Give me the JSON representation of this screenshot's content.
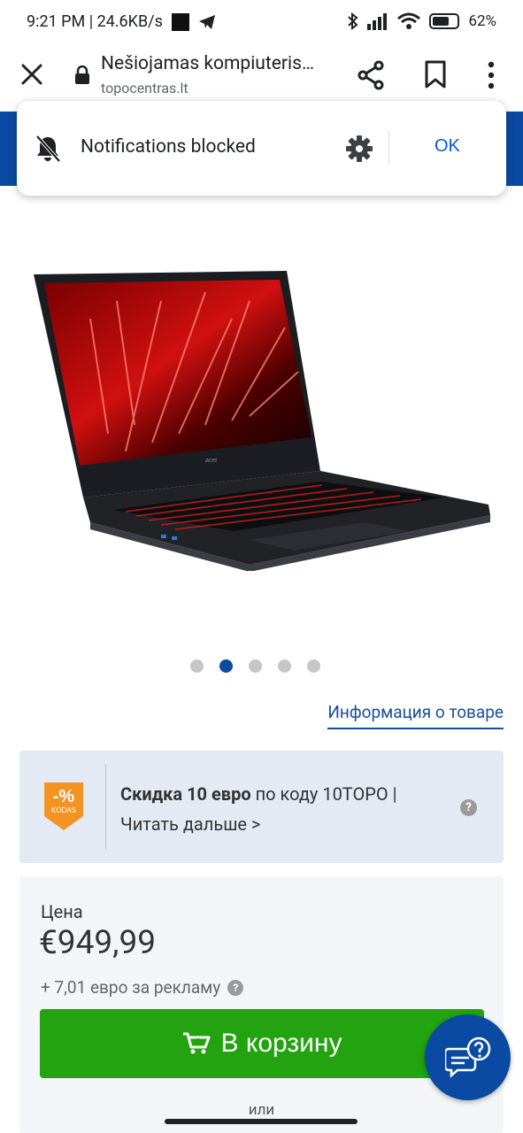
{
  "status_bar": {
    "time_speed": "9:21 PM | 24.6KB/s",
    "battery": "62%"
  },
  "browser": {
    "page_title": "Nešiojamas kompiuteris…",
    "url": "topocentras.lt"
  },
  "notification": {
    "text": "Notifications blocked",
    "ok_label": "OK"
  },
  "carousel": {
    "dot_count": 5,
    "active_index": 1
  },
  "product": {
    "info_link": "Информация о товаре",
    "promo_tag": "-% KODAS",
    "promo_bold": "Скидка 10 евро",
    "promo_rest": " по коду 10TOPO |",
    "promo_more": "Читать дальше >",
    "promo_help": "?",
    "price_label": "Цена",
    "price_value": "€949,99",
    "ad_fee": "+ 7,01 евро за рекламу",
    "ad_help": "?",
    "cart_button": "В корзину",
    "or_text": "или"
  },
  "colors": {
    "brand_blue": "#0b4aa2",
    "cart_green": "#22a30f",
    "promo_orange": "#f39322"
  }
}
